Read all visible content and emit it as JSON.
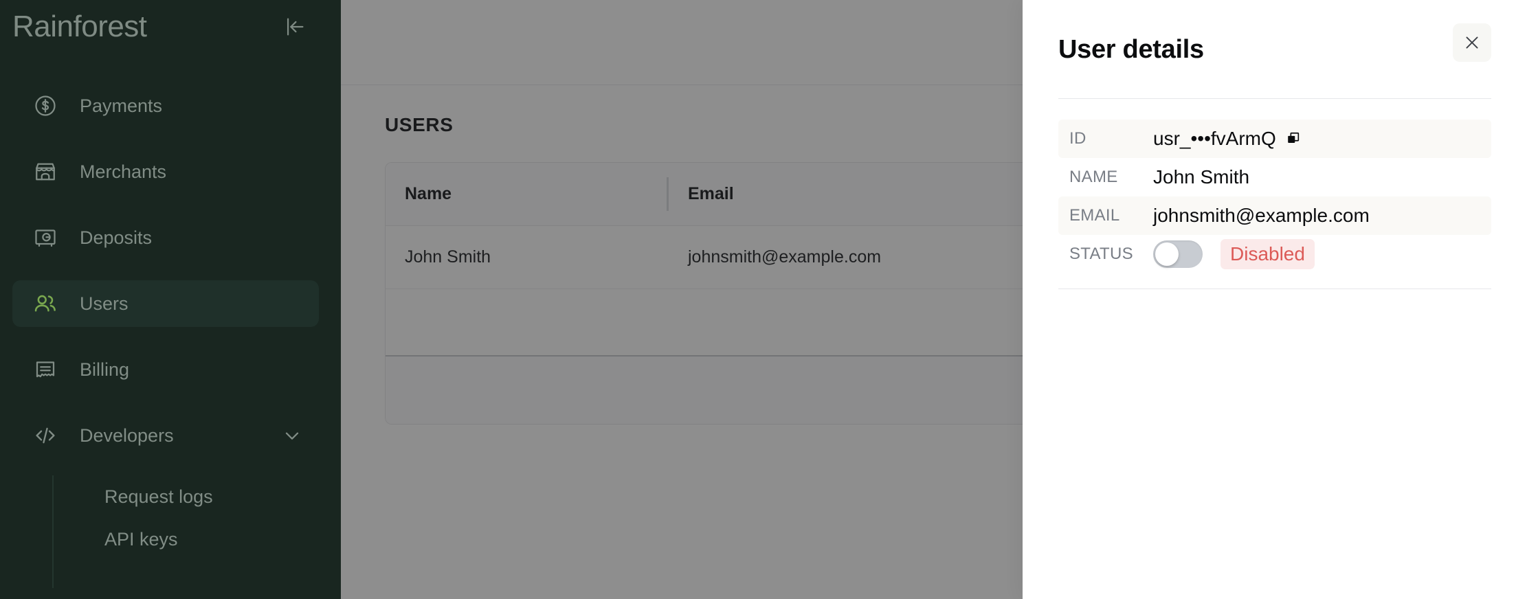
{
  "sidebar": {
    "brand": "Rainforest",
    "collapse_icon": "collapse-left-icon",
    "items": [
      {
        "label": "Payments",
        "icon": "dollar-circle-icon",
        "active": false
      },
      {
        "label": "Merchants",
        "icon": "storefront-icon",
        "active": false
      },
      {
        "label": "Deposits",
        "icon": "safe-vault-icon",
        "active": false
      },
      {
        "label": "Users",
        "icon": "users-icon",
        "active": true
      },
      {
        "label": "Billing",
        "icon": "receipt-icon",
        "active": false
      },
      {
        "label": "Developers",
        "icon": "code-brackets-icon",
        "active": false,
        "expandable": true
      }
    ],
    "sub_items": [
      {
        "label": "Request logs"
      },
      {
        "label": "API keys"
      }
    ],
    "active_color": "#7aa84f",
    "bg_color": "#192620"
  },
  "main": {
    "page_title": "USERS",
    "table": {
      "columns": [
        "Name",
        "Email"
      ],
      "rows": [
        {
          "name": "John Smith",
          "email": "johnsmith@example.com"
        }
      ]
    }
  },
  "drawer": {
    "title": "User details",
    "close_icon": "close-icon",
    "details": [
      {
        "key": "ID",
        "value": "usr_•••fvArmQ",
        "copy": true
      },
      {
        "key": "NAME",
        "value": "John Smith"
      },
      {
        "key": "EMAIL",
        "value": "johnsmith@example.com"
      },
      {
        "key": "STATUS",
        "value": "Disabled"
      }
    ],
    "status": {
      "label": "STATUS",
      "toggle_on": false,
      "badge_text": "Disabled",
      "badge_bg": "#FBEAEA",
      "badge_color": "#DC5A57"
    },
    "copy_icon": "copy-icon"
  }
}
